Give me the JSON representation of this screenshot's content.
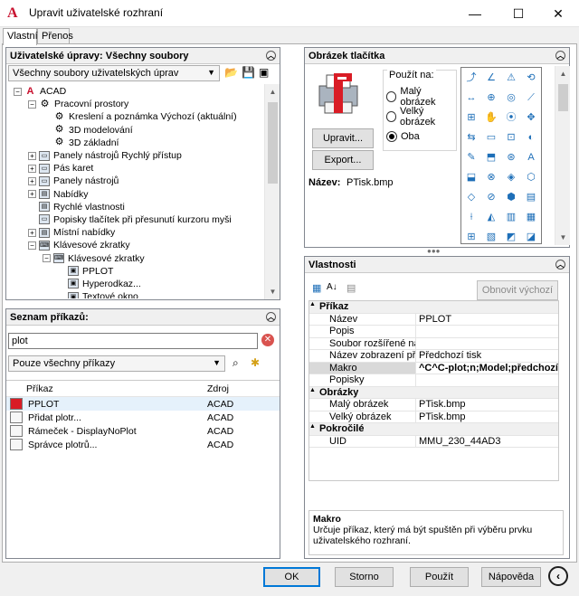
{
  "window": {
    "title": "Upravit uživatelské rozhraní",
    "minimize": "—",
    "maximize": "☐",
    "close": "✕"
  },
  "tabs": [
    {
      "label": "Vlastní"
    },
    {
      "label": "Přenos"
    }
  ],
  "customizations": {
    "header": "Uživatelské úpravy: Všechny soubory",
    "combo_value": "Všechny soubory uživatelských úprav",
    "tree": [
      {
        "label": "ACAD",
        "tog": "−",
        "icon": "A"
      },
      {
        "label": "Pracovní prostory",
        "tog": "−",
        "icon": "⚙"
      },
      {
        "label": "Kreslení a poznámka Výchozí (aktuální)",
        "tog": "",
        "icon": "⚙"
      },
      {
        "label": "3D modelování",
        "tog": "",
        "icon": "⚙"
      },
      {
        "label": "3D základní",
        "tog": "",
        "icon": "⚙"
      },
      {
        "label": "Panely nástrojů Rychlý přístup",
        "tog": "+",
        "icon": "▭"
      },
      {
        "label": "Pás karet",
        "tog": "+",
        "icon": "▭"
      },
      {
        "label": "Panely nástrojů",
        "tog": "+",
        "icon": "▭"
      },
      {
        "label": "Nabídky",
        "tog": "+",
        "icon": "▤"
      },
      {
        "label": "Rychlé vlastnosti",
        "tog": "",
        "icon": "▤"
      },
      {
        "label": "Popisky tlačítek při přesunutí kurzoru myši",
        "tog": "",
        "icon": "▭"
      },
      {
        "label": "Místní nabídky",
        "tog": "+",
        "icon": "▤"
      },
      {
        "label": "Klávesové zkratky",
        "tog": "−",
        "icon": "⌨"
      },
      {
        "label": "Klávesové zkratky",
        "tog": "−",
        "icon": "⌨"
      },
      {
        "label": "PPLOT",
        "tog": "",
        "icon": "▣"
      },
      {
        "label": "Hyperodkaz...",
        "tog": "",
        "icon": "▣"
      },
      {
        "label": "Textové okno",
        "tog": "",
        "icon": "▣"
      }
    ]
  },
  "command_list": {
    "header": "Seznam příkazů:",
    "search_value": "plot",
    "filter_value": "Pouze všechny příkazy",
    "col_command": "Příkaz",
    "col_source": "Zdroj",
    "rows": [
      {
        "name": "PPLOT",
        "source": "ACAD"
      },
      {
        "name": "Přidat plotr...",
        "source": "ACAD"
      },
      {
        "name": "Rámeček - DisplayNoPlot",
        "source": "ACAD"
      },
      {
        "name": "Správce plotrů...",
        "source": "ACAD"
      }
    ]
  },
  "button_image": {
    "header": "Obrázek tlačítka",
    "use_for_label": "Použít na:",
    "radio_small": "Malý obrázek",
    "radio_large": "Velký obrázek",
    "radio_both": "Oba",
    "edit_button": "Upravit...",
    "export_button": "Export...",
    "name_label": "Název:",
    "name_value": "PTisk.bmp"
  },
  "properties": {
    "header": "Vlastnosti",
    "reset_button": "Obnovit výchozí",
    "cat_command": "Příkaz",
    "cat_images": "Obrázky",
    "cat_advanced": "Pokročilé",
    "rows_command": [
      {
        "k": "Název",
        "v": "PPLOT"
      },
      {
        "k": "Popis",
        "v": ""
      },
      {
        "k": "Soubor rozšířené nabídky",
        "v": ""
      },
      {
        "k": "Název zobrazení příkazu",
        "v": "Předchozí tisk"
      },
      {
        "k": "Makro",
        "v": "^C^C-plot;n;Model;předchozí"
      },
      {
        "k": "Popisky",
        "v": ""
      }
    ],
    "rows_images": [
      {
        "k": "Malý obrázek",
        "v": "PTisk.bmp"
      },
      {
        "k": "Velký obrázek",
        "v": "PTisk.bmp"
      }
    ],
    "rows_advanced": [
      {
        "k": "UID",
        "v": "MMU_230_44AD3"
      }
    ],
    "help_title": "Makro",
    "help_text": "Určuje příkaz, který má být spuštěn při výběru prvku uživatelského rozhraní."
  },
  "footer": {
    "ok": "OK",
    "cancel": "Storno",
    "apply": "Použít",
    "help": "Nápověda"
  },
  "colors": {
    "accent": "#0078d7",
    "logo_red": "#c8102e"
  }
}
